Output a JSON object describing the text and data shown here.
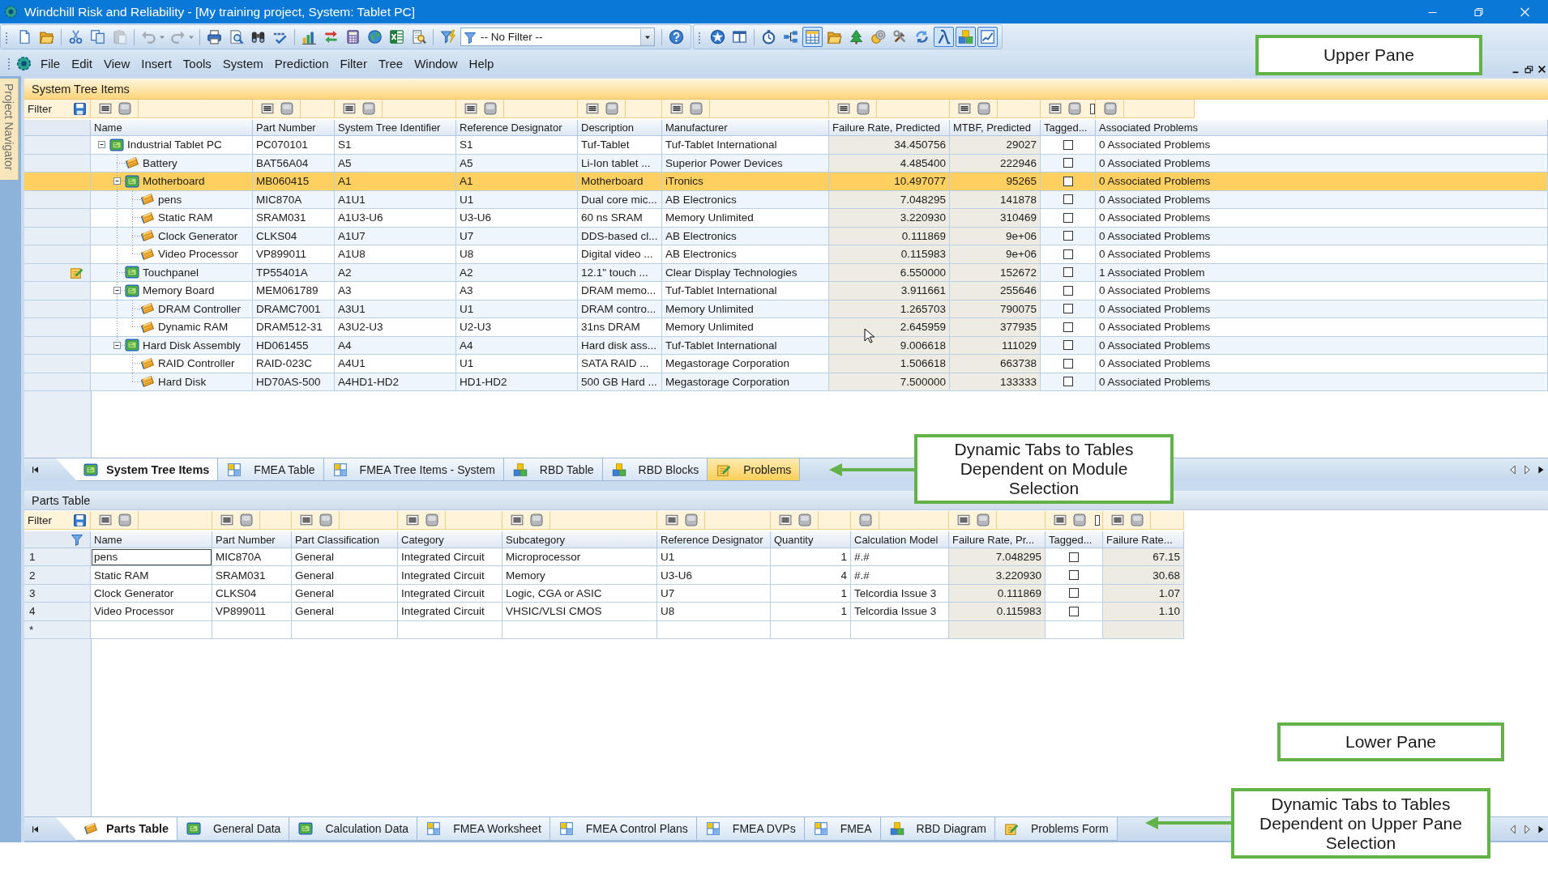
{
  "window": {
    "title": "Windchill Risk and Reliability - [My training project, System: Tablet PC]"
  },
  "toolbar": {
    "standard_buttons": [
      {
        "disabled": false
      },
      {
        "disabled": false
      },
      {
        "disabled": false
      },
      {
        "disabled": false
      },
      {
        "disabled": true
      },
      {
        "disabled": true
      },
      {
        "disabled": true
      },
      {
        "disabled": false
      },
      {
        "disabled": false
      },
      {
        "disabled": false
      },
      {
        "disabled": false
      },
      {
        "disabled": false
      },
      {
        "disabled": false
      },
      {
        "disabled": false
      },
      {
        "disabled": false
      },
      {
        "disabled": false
      },
      {
        "disabled": false
      },
      {
        "disabled": false
      },
      {
        "disabled": false
      }
    ],
    "filter_select": {
      "value": "-- No Filter --"
    },
    "module_buttons": [
      {
        "pressed": false
      },
      {
        "pressed": false
      },
      {
        "pressed": false
      },
      {
        "pressed": false
      },
      {
        "pressed": true
      },
      {
        "pressed": false
      },
      {
        "pressed": false
      },
      {
        "pressed": false
      },
      {
        "pressed": false
      },
      {
        "pressed": false
      },
      {
        "pressed": true
      },
      {
        "pressed": true
      },
      {
        "pressed": true
      }
    ]
  },
  "menu": [
    "File",
    "Edit",
    "View",
    "Insert",
    "Tools",
    "System",
    "Prediction",
    "Filter",
    "Tree",
    "Window",
    "Help"
  ],
  "side_panel": {
    "tab": "Project Navigator"
  },
  "upper_pane": {
    "title": "System Tree Items",
    "filter_label": "Filter",
    "columns": [
      {
        "label": "Name",
        "kind": "tree"
      },
      {
        "label": "Part Number",
        "kind": "text"
      },
      {
        "label": "System Tree Identifier",
        "kind": "text"
      },
      {
        "label": "Reference Designator",
        "kind": "text"
      },
      {
        "label": "Description",
        "kind": "text"
      },
      {
        "label": "Manufacturer",
        "kind": "text"
      },
      {
        "label": "Failure Rate, Predicted",
        "kind": "computed"
      },
      {
        "label": "MTBF, Predicted",
        "kind": "computed"
      },
      {
        "label": "Tagged...",
        "kind": "check"
      },
      {
        "label": "Associated Problems",
        "kind": "choice"
      }
    ],
    "items": [
      {
        "name": "Industrial Tablet PC",
        "kind": "assembly",
        "expanded": true,
        "selected": false,
        "problem_flag": false,
        "part_number": "PC070101",
        "system_tree_identifier": "S1",
        "reference_designator": "S1",
        "description": "Tuf-Tablet",
        "manufacturer": "Tuf-Tablet International",
        "failure_rate_predicted": "34.450756",
        "mtbf_predicted": "29027",
        "tagged": false,
        "associated_problems": "0 Associated Problems",
        "children": [
          {
            "name": "Battery",
            "kind": "part",
            "selected": false,
            "problem_flag": false,
            "part_number": "BAT56A04",
            "system_tree_identifier": "A5",
            "reference_designator": "A5",
            "description": "Li-Ion tablet ...",
            "manufacturer": "Superior Power Devices",
            "failure_rate_predicted": "4.485400",
            "mtbf_predicted": "222946",
            "tagged": false,
            "associated_problems": "0 Associated Problems"
          },
          {
            "name": "Motherboard",
            "kind": "assembly",
            "expanded": true,
            "selected": true,
            "problem_flag": false,
            "part_number": "MB060415",
            "system_tree_identifier": "A1",
            "reference_designator": "A1",
            "description": "Motherboard",
            "manufacturer": "iTronics",
            "failure_rate_predicted": "10.497077",
            "mtbf_predicted": "95265",
            "tagged": false,
            "associated_problems": "0 Associated Problems",
            "children": [
              {
                "name": "pens",
                "kind": "part",
                "selected": false,
                "problem_flag": false,
                "part_number": "MIC870A",
                "system_tree_identifier": "A1U1",
                "reference_designator": "U1",
                "description": "Dual core mic...",
                "manufacturer": "AB Electronics",
                "failure_rate_predicted": "7.048295",
                "mtbf_predicted": "141878",
                "tagged": false,
                "associated_problems": "0 Associated Problems"
              },
              {
                "name": "Static RAM",
                "kind": "part",
                "selected": false,
                "problem_flag": false,
                "part_number": "SRAM031",
                "system_tree_identifier": "A1U3-U6",
                "reference_designator": "U3-U6",
                "description": "60 ns SRAM",
                "manufacturer": "Memory Unlimited",
                "failure_rate_predicted": "3.220930",
                "mtbf_predicted": "310469",
                "tagged": false,
                "associated_problems": "0 Associated Problems"
              },
              {
                "name": "Clock Generator",
                "kind": "part",
                "selected": false,
                "problem_flag": false,
                "part_number": "CLKS04",
                "system_tree_identifier": "A1U7",
                "reference_designator": "U7",
                "description": "DDS-based cl...",
                "manufacturer": "AB Electronics",
                "failure_rate_predicted": "0.111869",
                "mtbf_predicted": "9e+06",
                "tagged": false,
                "associated_problems": "0 Associated Problems"
              },
              {
                "name": "Video Processor",
                "kind": "part",
                "selected": false,
                "problem_flag": false,
                "part_number": "VP899011",
                "system_tree_identifier": "A1U8",
                "reference_designator": "U8",
                "description": "Digital video ...",
                "manufacturer": "AB Electronics",
                "failure_rate_predicted": "0.115983",
                "mtbf_predicted": "9e+06",
                "tagged": false,
                "associated_problems": "0 Associated Problems"
              }
            ]
          },
          {
            "name": "Touchpanel",
            "kind": "assembly",
            "selected": false,
            "problem_flag": true,
            "part_number": "TP55401A",
            "system_tree_identifier": "A2",
            "reference_designator": "A2",
            "description": "12.1\" touch ...",
            "manufacturer": "Clear Display Technologies",
            "failure_rate_predicted": "6.550000",
            "mtbf_predicted": "152672",
            "tagged": false,
            "associated_problems": "1 Associated Problem"
          },
          {
            "name": "Memory Board",
            "kind": "assembly",
            "expanded": true,
            "selected": false,
            "problem_flag": false,
            "part_number": "MEM061789",
            "system_tree_identifier": "A3",
            "reference_designator": "A3",
            "description": "DRAM memo...",
            "manufacturer": "Tuf-Tablet International",
            "failure_rate_predicted": "3.911661",
            "mtbf_predicted": "255646",
            "tagged": false,
            "associated_problems": "0 Associated Problems",
            "children": [
              {
                "name": "DRAM Controller",
                "kind": "part",
                "selected": false,
                "problem_flag": false,
                "part_number": "DRAMC7001",
                "system_tree_identifier": "A3U1",
                "reference_designator": "U1",
                "description": "DRAM contro...",
                "manufacturer": "Memory Unlimited",
                "failure_rate_predicted": "1.265703",
                "mtbf_predicted": "790075",
                "tagged": false,
                "associated_problems": "0 Associated Problems"
              },
              {
                "name": "Dynamic RAM",
                "kind": "part",
                "selected": false,
                "problem_flag": false,
                "part_number": "DRAM512-31",
                "system_tree_identifier": "A3U2-U3",
                "reference_designator": "U2-U3",
                "description": "31ns DRAM",
                "manufacturer": "Memory Unlimited",
                "failure_rate_predicted": "2.645959",
                "mtbf_predicted": "377935",
                "tagged": false,
                "associated_problems": "0 Associated Problems"
              }
            ]
          },
          {
            "name": "Hard Disk Assembly",
            "kind": "assembly",
            "expanded": true,
            "selected": false,
            "problem_flag": false,
            "part_number": "HD061455",
            "system_tree_identifier": "A4",
            "reference_designator": "A4",
            "description": "Hard disk ass...",
            "manufacturer": "Tuf-Tablet International",
            "failure_rate_predicted": "9.006618",
            "mtbf_predicted": "111029",
            "tagged": false,
            "associated_problems": "0 Associated Problems",
            "children": [
              {
                "name": "RAID Controller",
                "kind": "part",
                "selected": false,
                "problem_flag": false,
                "part_number": "RAID-023C",
                "system_tree_identifier": "A4U1",
                "reference_designator": "U1",
                "description": "SATA RAID ...",
                "manufacturer": "Megastorage Corporation",
                "failure_rate_predicted": "1.506618",
                "mtbf_predicted": "663738",
                "tagged": false,
                "associated_problems": "0 Associated Problems"
              },
              {
                "name": "Hard Disk",
                "kind": "part",
                "selected": false,
                "problem_flag": false,
                "part_number": "HD70AS-500",
                "system_tree_identifier": "A4HD1-HD2",
                "reference_designator": "HD1-HD2",
                "description": "500 GB Hard ...",
                "manufacturer": "Megastorage Corporation",
                "failure_rate_predicted": "7.500000",
                "mtbf_predicted": "133333",
                "tagged": false,
                "associated_problems": "0 Associated Problems"
              }
            ]
          }
        ]
      }
    ],
    "tabs": [
      {
        "label": "System Tree Items",
        "kind": "tree",
        "selected": true,
        "highlighted": false
      },
      {
        "label": "FMEA Table",
        "kind": "fmea",
        "selected": false,
        "highlighted": false
      },
      {
        "label": "FMEA Tree Items - System",
        "kind": "fmea",
        "selected": false,
        "highlighted": false
      },
      {
        "label": "RBD Table",
        "kind": "rbd",
        "selected": false,
        "highlighted": false
      },
      {
        "label": "RBD Blocks",
        "kind": "rbd",
        "selected": false,
        "highlighted": false
      },
      {
        "label": "Problems",
        "kind": "problems",
        "selected": false,
        "highlighted": true
      }
    ]
  },
  "lower_pane": {
    "title": "Parts Table",
    "filter_label": "Filter",
    "columns": [
      {
        "label": "Name",
        "kind": "text"
      },
      {
        "label": "Part Number",
        "kind": "text"
      },
      {
        "label": "Part Classification",
        "kind": "text"
      },
      {
        "label": "Category",
        "kind": "text"
      },
      {
        "label": "Subcategory",
        "kind": "text"
      },
      {
        "label": "Reference Designator",
        "kind": "text"
      },
      {
        "label": "Quantity",
        "kind": "number"
      },
      {
        "label": "Calculation Model",
        "kind": "choice"
      },
      {
        "label": "Failure Rate, Pr...",
        "kind": "computed"
      },
      {
        "label": "Tagged...",
        "kind": "check"
      },
      {
        "label": "Failure Rate...",
        "kind": "computed"
      }
    ],
    "rows": [
      {
        "row_number": "1",
        "selected": false,
        "focused": true,
        "name": "pens",
        "part_number": "MIC870A",
        "part_classification": "General",
        "category": "Integrated Circuit",
        "subcategory": "Microprocessor",
        "reference_designator": "U1",
        "quantity": "1",
        "calculation_model": "#.#",
        "failure_rate_predicted": "7.048295",
        "tagged": false,
        "failure_rate": "67.15"
      },
      {
        "row_number": "2",
        "selected": false,
        "focused": false,
        "name": "Static RAM",
        "part_number": "SRAM031",
        "part_classification": "General",
        "category": "Integrated Circuit",
        "subcategory": "Memory",
        "reference_designator": "U3-U6",
        "quantity": "4",
        "calculation_model": "#.#",
        "failure_rate_predicted": "3.220930",
        "tagged": false,
        "failure_rate": "30.68"
      },
      {
        "row_number": "3",
        "selected": false,
        "focused": false,
        "name": "Clock Generator",
        "part_number": "CLKS04",
        "part_classification": "General",
        "category": "Integrated Circuit",
        "subcategory": "Logic, CGA or ASIC",
        "reference_designator": "U7",
        "quantity": "1",
        "calculation_model": "Telcordia Issue 3",
        "failure_rate_predicted": "0.111869",
        "tagged": false,
        "failure_rate": "1.07"
      },
      {
        "row_number": "4",
        "selected": false,
        "focused": false,
        "name": "Video Processor",
        "part_number": "VP899011",
        "part_classification": "General",
        "category": "Integrated Circuit",
        "subcategory": "VHSIC/VLSI CMOS",
        "reference_designator": "U8",
        "quantity": "1",
        "calculation_model": "Telcordia Issue 3",
        "failure_rate_predicted": "0.115983",
        "tagged": false,
        "failure_rate": "1.10"
      }
    ],
    "new_row_marker": "*",
    "tabs": [
      {
        "label": "Parts Table",
        "kind": "parts",
        "selected": true,
        "highlighted": false
      },
      {
        "label": "General Data",
        "kind": "tree",
        "selected": false,
        "highlighted": false
      },
      {
        "label": "Calculation Data",
        "kind": "tree",
        "selected": false,
        "highlighted": false
      },
      {
        "label": "FMEA Worksheet",
        "kind": "fmea",
        "selected": false,
        "highlighted": false
      },
      {
        "label": "FMEA Control Plans",
        "kind": "fmea",
        "selected": false,
        "highlighted": false
      },
      {
        "label": "FMEA DVPs",
        "kind": "fmea",
        "selected": false,
        "highlighted": false
      },
      {
        "label": "FMEA",
        "kind": "fmea",
        "selected": false,
        "highlighted": false
      },
      {
        "label": "RBD Diagram",
        "kind": "rbd",
        "selected": false,
        "highlighted": false
      },
      {
        "label": "Problems Form",
        "kind": "problems",
        "selected": false,
        "highlighted": false
      }
    ]
  },
  "annotations": [
    {
      "text": "Upper Pane",
      "arrow": false
    },
    {
      "text": "Dynamic Tabs to Tables Dependent on Module Selection",
      "arrow": true
    },
    {
      "text": "Lower Pane",
      "arrow": false
    },
    {
      "text": "Dynamic Tabs to Tables Dependent on Upper Pane Selection",
      "arrow": true
    }
  ]
}
